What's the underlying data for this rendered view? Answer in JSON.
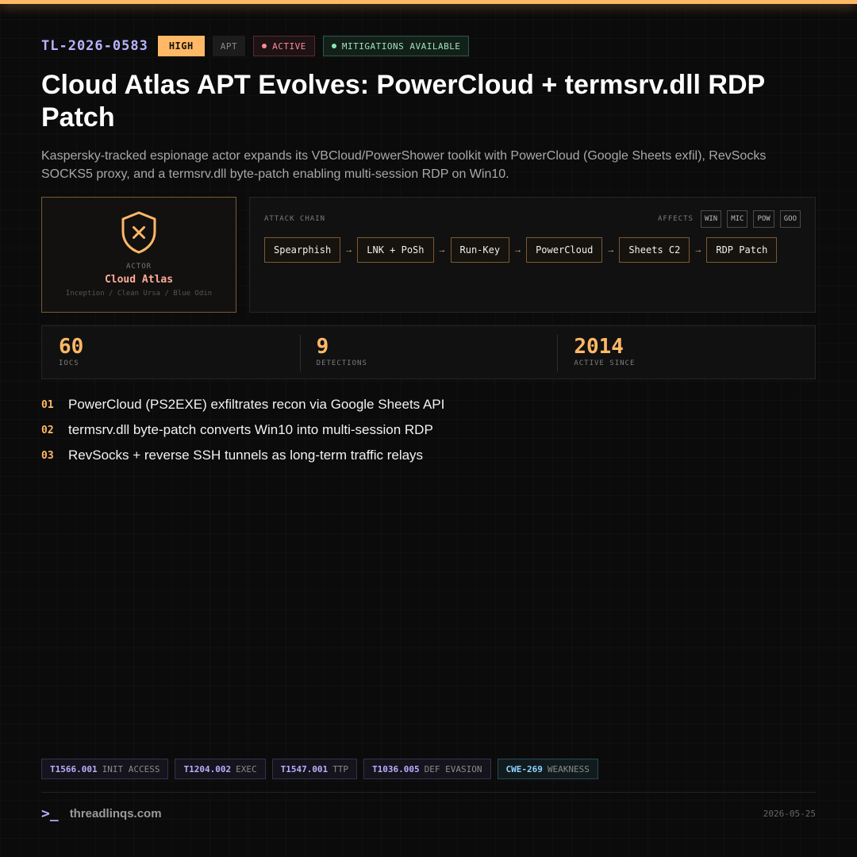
{
  "header": {
    "ticket_id": "TL-2026-0583",
    "severity": "HIGH",
    "category": "APT",
    "status": "ACTIVE",
    "mitigation": "MITIGATIONS AVAILABLE"
  },
  "title": "Cloud Atlas APT Evolves: PowerCloud + termsrv.dll RDP Patch",
  "subtitle": "Kaspersky-tracked espionage actor expands its VBCloud/PowerShower toolkit with PowerCloud (Google Sheets exfil), RevSocks SOCKS5 proxy, and a termsrv.dll byte-patch enabling multi-session RDP on Win10.",
  "actor": {
    "label": "ACTOR",
    "name": "Cloud Atlas",
    "aliases": "Inception / Clean Ursa / Blue Odin",
    "icon": "shield-x-icon"
  },
  "attack_chain": {
    "label": "ATTACK CHAIN",
    "affects_label": "AFFECTS",
    "platforms": [
      "WIN",
      "MIC",
      "POW",
      "GOO"
    ],
    "steps": [
      "Spearphish",
      "LNK + PoSh",
      "Run-Key",
      "PowerCloud",
      "Sheets C2",
      "RDP Patch"
    ],
    "arrow": "→"
  },
  "stats": [
    {
      "value": "60",
      "label": "IOCS"
    },
    {
      "value": "9",
      "label": "DETECTIONS"
    },
    {
      "value": "2014",
      "label": "ACTIVE SINCE"
    }
  ],
  "findings": [
    {
      "num": "01",
      "text": "PowerCloud (PS2EXE) exfiltrates recon via Google Sheets API"
    },
    {
      "num": "02",
      "text": "termsrv.dll byte-patch converts Win10 into multi-session RDP"
    },
    {
      "num": "03",
      "text": "RevSocks + reverse SSH tunnels as long-term traffic relays"
    }
  ],
  "tags": [
    {
      "id": "T1566.001",
      "desc": "INIT ACCESS"
    },
    {
      "id": "T1204.002",
      "desc": "EXEC"
    },
    {
      "id": "T1547.001",
      "desc": "TTP"
    },
    {
      "id": "T1036.005",
      "desc": "DEF EVASION"
    },
    {
      "id": "CWE-269",
      "desc": "WEAKNESS"
    }
  ],
  "footer": {
    "prompt": ">_",
    "site": "threadlinqs.com",
    "date": "2026-05-25"
  },
  "colors": {
    "accent": "#ffb866",
    "id_purple": "#b9b3ff",
    "active_red": "#ff8a95",
    "mitigation_green": "#9fe0bf",
    "actor_name": "#ffab98"
  }
}
